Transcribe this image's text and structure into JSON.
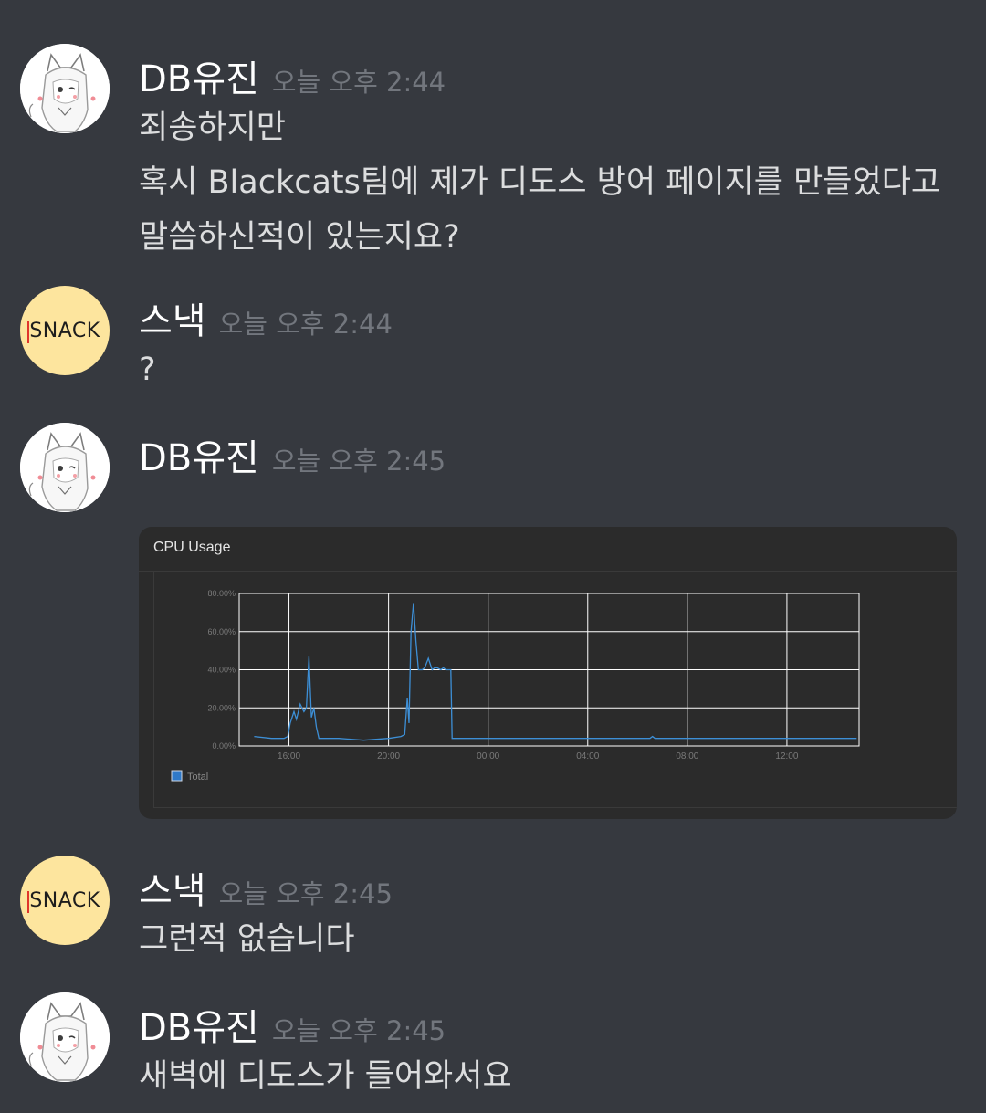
{
  "messages": [
    {
      "author": "DB유진",
      "time": "오늘 오후 2:44",
      "lines": [
        "죄송하지만",
        "혹시 Blackcats팀에 제가 디도스 방어 페이지를 만들었다고",
        "말씀하신적이 있는지요?"
      ]
    },
    {
      "author": "스낵",
      "avatar_text": "SNACK",
      "time": "오늘 오후 2:44",
      "lines": [
        "?"
      ]
    },
    {
      "author": "DB유진",
      "time": "오늘 오후 2:45",
      "attachment_title": "CPU Usage"
    },
    {
      "author": "스낵",
      "avatar_text": "SNACK",
      "time": "오늘 오후 2:45",
      "lines": [
        "그런적 없습니다"
      ]
    },
    {
      "author": "DB유진",
      "time": "오늘 오후 2:45",
      "lines": [
        "새벽에 디도스가 들어와서요"
      ]
    }
  ],
  "colors": {
    "background": "#36393f",
    "username": "#ffffff",
    "timestamp": "#72767d",
    "text": "#dcddde",
    "snack_avatar": "#fde59e",
    "chart_bg": "#2b2b2b",
    "chart_line": "#3d8fd6",
    "grid": "#ffffff"
  },
  "chart_data": {
    "type": "line",
    "title": "CPU Usage",
    "ylim": [
      0,
      80
    ],
    "yticks": [
      "0.00%",
      "20.00%",
      "40.00%",
      "60.00%",
      "80.00%"
    ],
    "xticks": [
      "16:00",
      "20:00",
      "00:00",
      "04:00",
      "08:00",
      "12:00"
    ],
    "legend": "top-left below chart",
    "grid": true,
    "series": [
      {
        "name": "Total",
        "x": [
          14.6,
          15.3,
          15.8,
          15.95,
          16.05,
          16.2,
          16.3,
          16.45,
          16.6,
          16.7,
          16.8,
          16.9,
          17.0,
          17.1,
          17.2,
          17.3,
          17.4,
          17.6,
          18.0,
          19.0,
          20.0,
          20.5,
          20.65,
          20.75,
          20.82,
          20.9,
          21.0,
          21.1,
          21.2,
          21.35,
          21.45,
          21.6,
          21.75,
          21.85,
          21.95,
          22.1,
          22.2,
          22.3,
          22.5,
          22.55,
          23.0,
          24.0,
          26.0,
          28.0,
          30.0,
          30.5,
          30.6,
          30.7,
          32.0,
          34.0,
          36.0,
          38.0,
          38.8
        ],
        "values": [
          5,
          4,
          4,
          5,
          12,
          18,
          14,
          22,
          18,
          20,
          47,
          15,
          20,
          10,
          4,
          4,
          4,
          4,
          4,
          3,
          4,
          5,
          6,
          25,
          12,
          60,
          75,
          55,
          40,
          40,
          41,
          46,
          40,
          41,
          41,
          40,
          41,
          40,
          40,
          4,
          4,
          4,
          4,
          4,
          4,
          4,
          5,
          4,
          4,
          4,
          4,
          4,
          4
        ]
      }
    ]
  }
}
